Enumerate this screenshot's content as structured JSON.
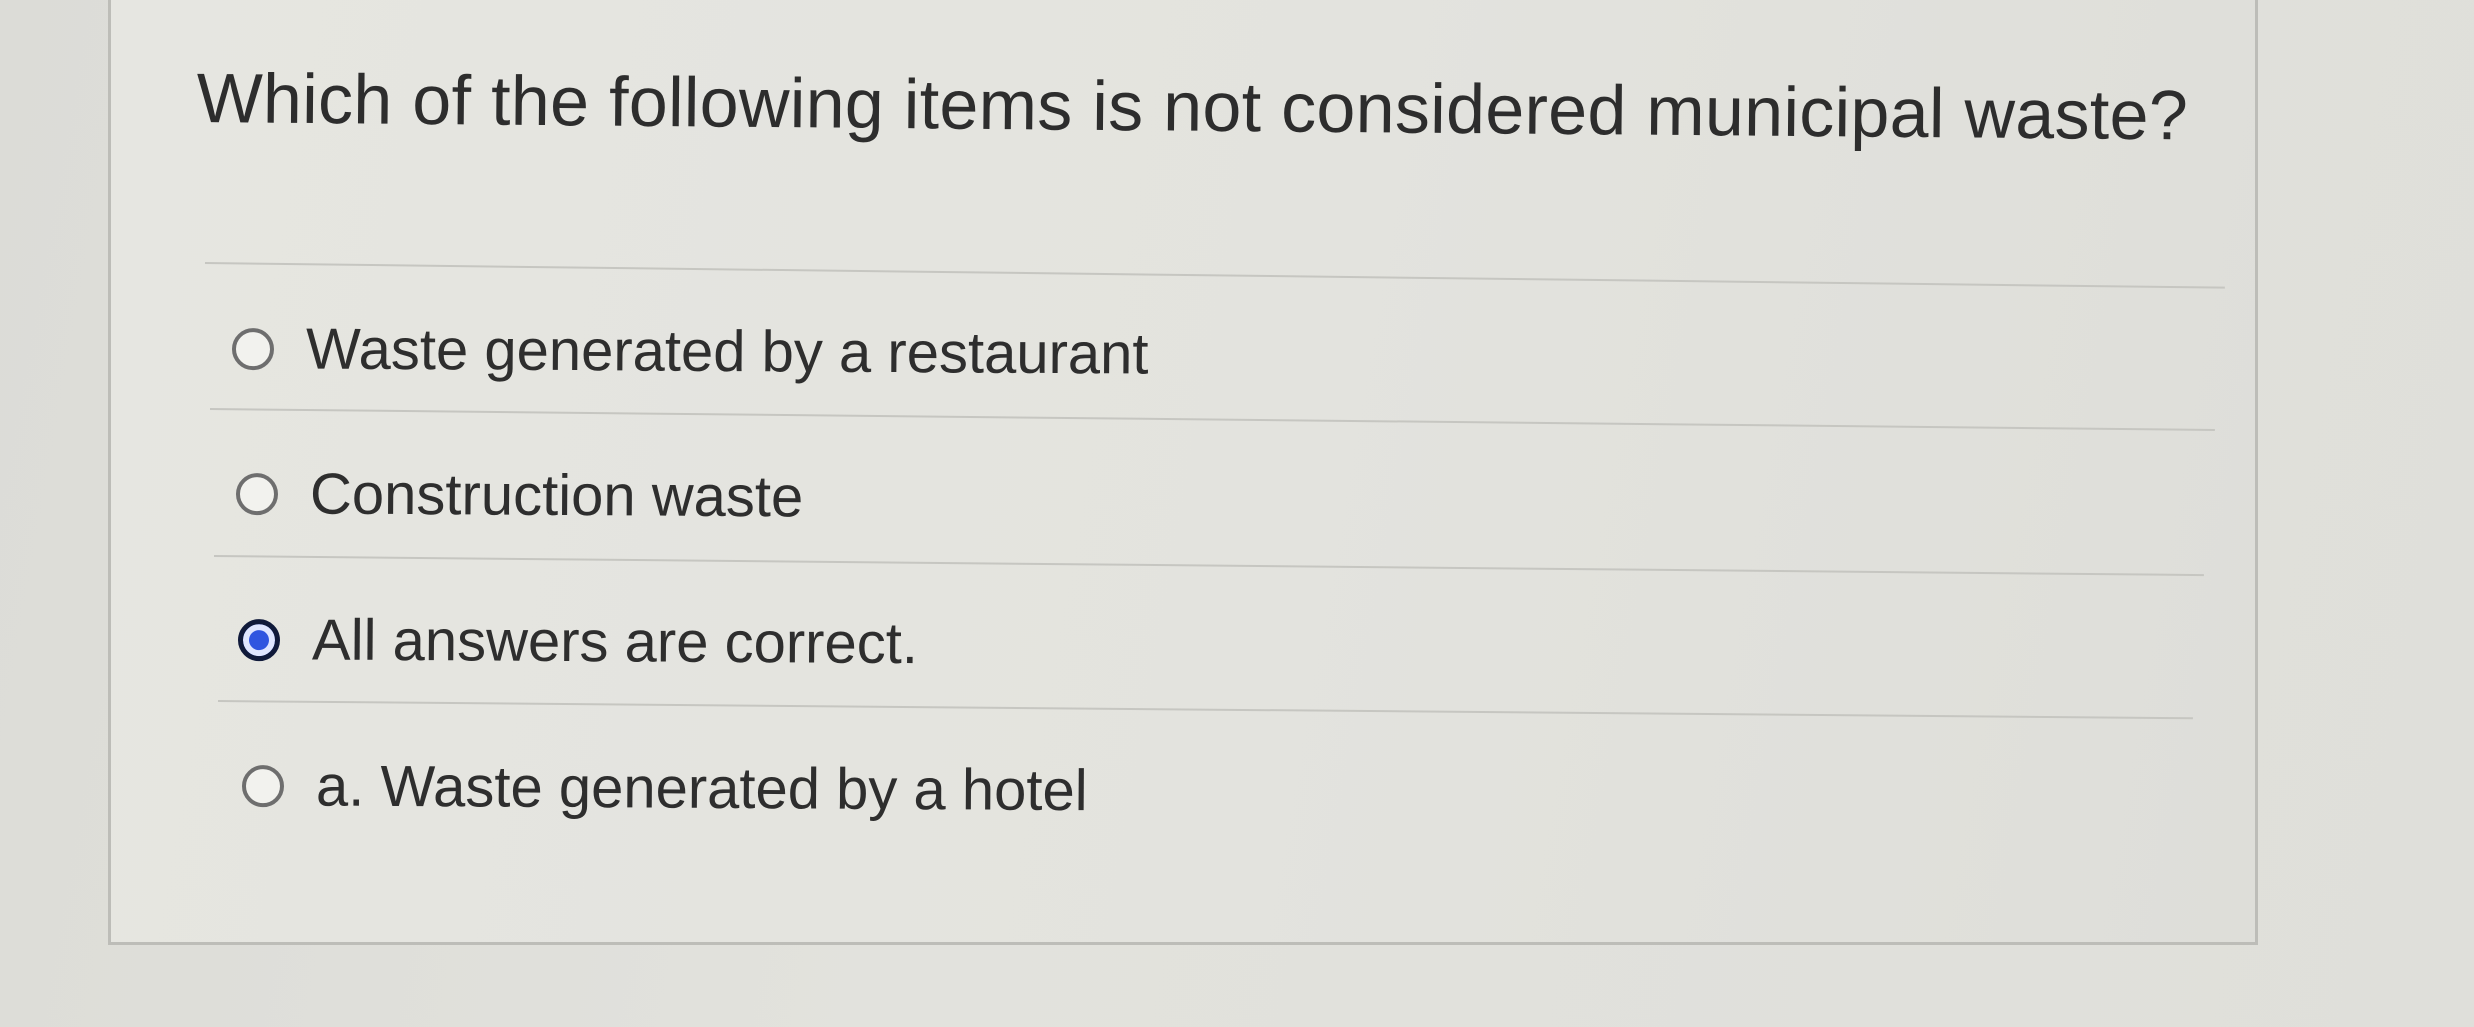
{
  "question": {
    "text": "Which of the following items is not considered municipal waste?"
  },
  "options": [
    {
      "label": "Waste generated by a restaurant",
      "selected": false
    },
    {
      "label": "Construction waste",
      "selected": false
    },
    {
      "label": "All answers are correct.",
      "selected": true
    },
    {
      "label": "a. Waste generated by a hotel",
      "selected": false
    }
  ],
  "colors": {
    "selected_radio": "#2f55e0",
    "text": "#2e2e2e"
  }
}
